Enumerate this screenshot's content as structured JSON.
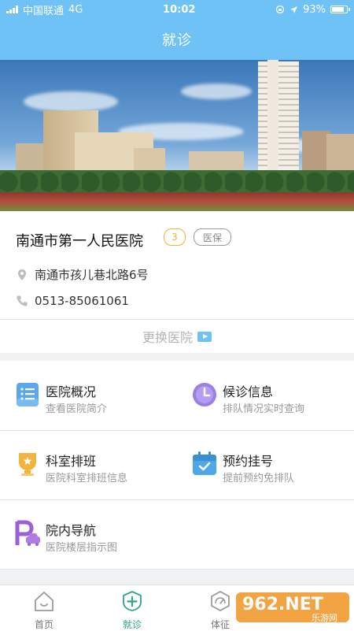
{
  "status_bar": {
    "carrier": "中国联通",
    "network": "4G",
    "time": "10:02",
    "battery": "93%",
    "battery_level": 0.93
  },
  "header": {
    "title": "就诊"
  },
  "hospital": {
    "name": "南通市第一人民医院",
    "level_badge": "3",
    "insurance_badge": "医保",
    "address": "南通市孩儿巷北路6号",
    "phone": "0513-85061061"
  },
  "change_hospital": {
    "label": "更换医院"
  },
  "menu": [
    {
      "title": "医院概况",
      "subtitle": "查看医院简介",
      "icon": "document-list-icon"
    },
    {
      "title": "候诊信息",
      "subtitle": "排队情况实时查询",
      "icon": "clock-icon"
    },
    {
      "title": "科室排班",
      "subtitle": "医院科室排班信息",
      "icon": "trophy-icon"
    },
    {
      "title": "预约挂号",
      "subtitle": "提前预约免排队",
      "icon": "calendar-check-icon"
    },
    {
      "title": "院内导航",
      "subtitle": "医院楼层指示图",
      "icon": "parking-car-icon"
    }
  ],
  "tabs": [
    {
      "label": "首页",
      "icon": "home-icon",
      "active": false
    },
    {
      "label": "就诊",
      "icon": "medical-cross-icon",
      "active": true
    },
    {
      "label": "体征",
      "icon": "gauge-icon",
      "active": false
    }
  ],
  "watermark": {
    "brand": "962.NET",
    "sub": "乐游网"
  },
  "colors": {
    "accent": "#6ec2f5",
    "active_tab": "#2fa38a",
    "badge_level": "#f2b233"
  }
}
